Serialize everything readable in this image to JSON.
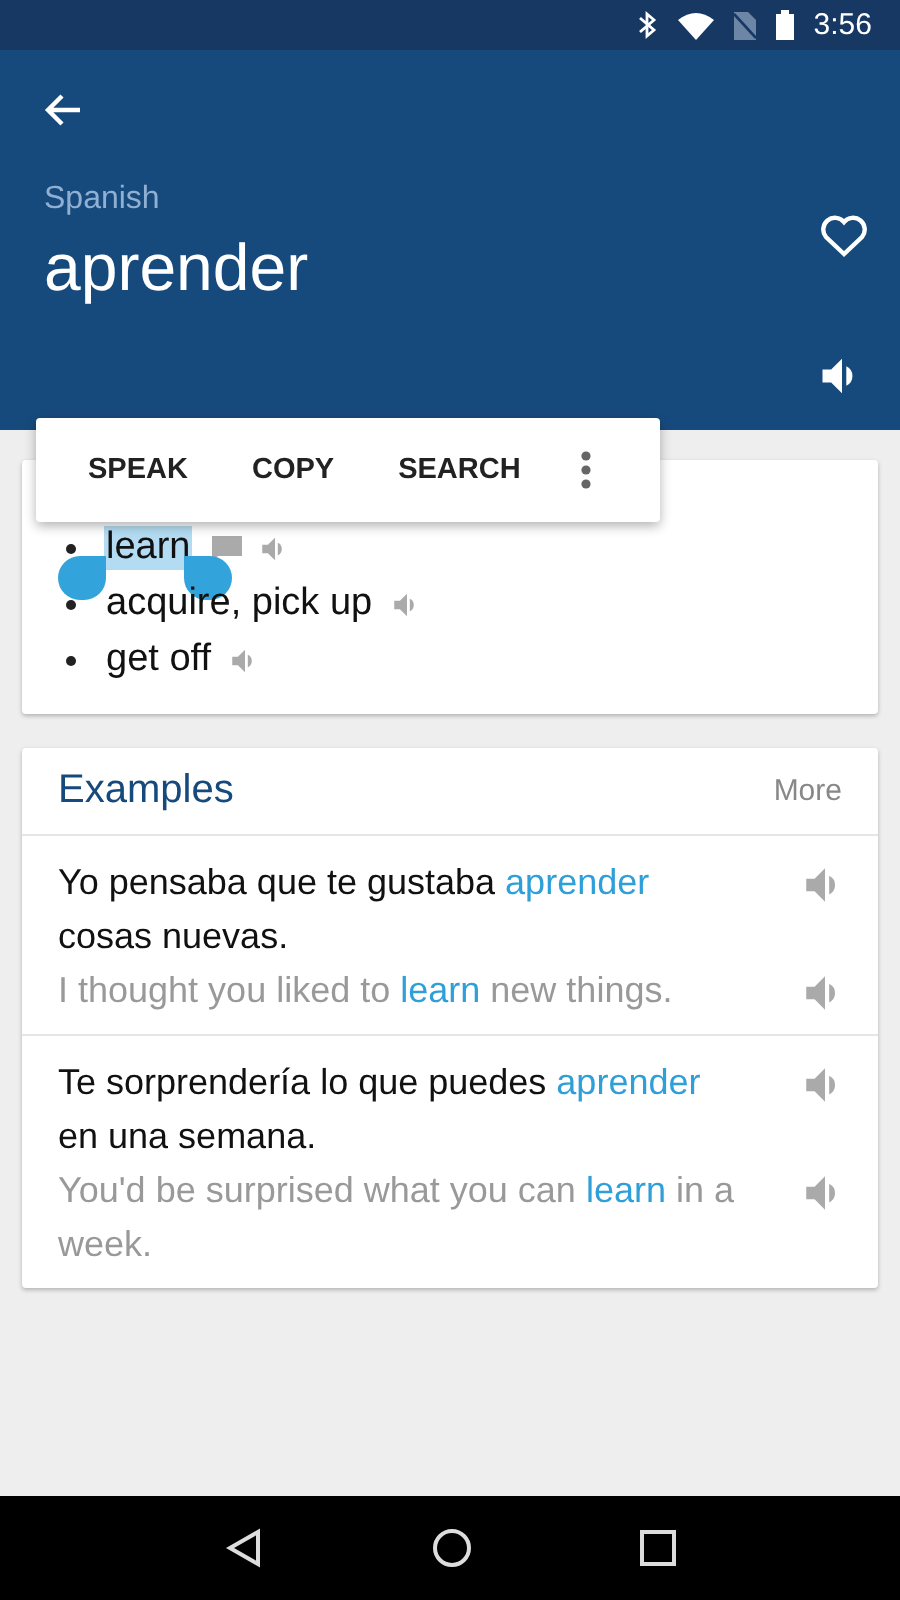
{
  "status_bar": {
    "time": "3:56"
  },
  "header": {
    "language": "Spanish",
    "word": "aprender",
    "favorite": false
  },
  "selection_menu": {
    "actions": [
      "SPEAK",
      "COPY",
      "SEARCH"
    ]
  },
  "translations": [
    {
      "text": "learn",
      "selected": true,
      "has_note": true
    },
    {
      "text": "acquire, pick up",
      "selected": false,
      "has_note": false
    },
    {
      "text": "get off",
      "selected": false,
      "has_note": false
    }
  ],
  "examples": {
    "title": "Examples",
    "more": "More",
    "items": [
      {
        "source": [
          {
            "text": "Yo pensaba que te gustaba ",
            "highlight": false
          },
          {
            "text": "aprender",
            "highlight": true
          },
          {
            "text": " cosas nuevas.",
            "highlight": false
          }
        ],
        "target": [
          {
            "text": "I thought you liked to ",
            "highlight": false
          },
          {
            "text": "learn",
            "highlight": true
          },
          {
            "text": " new things.",
            "highlight": false
          }
        ]
      },
      {
        "source": [
          {
            "text": "Te sorprendería lo que puedes ",
            "highlight": false
          },
          {
            "text": "aprender",
            "highlight": true
          },
          {
            "text": " en una semana.",
            "highlight": false
          }
        ],
        "target": [
          {
            "text": "You'd be surprised what you can ",
            "highlight": false
          },
          {
            "text": "learn",
            "highlight": true
          },
          {
            "text": " in a week.",
            "highlight": false
          }
        ]
      }
    ]
  }
}
